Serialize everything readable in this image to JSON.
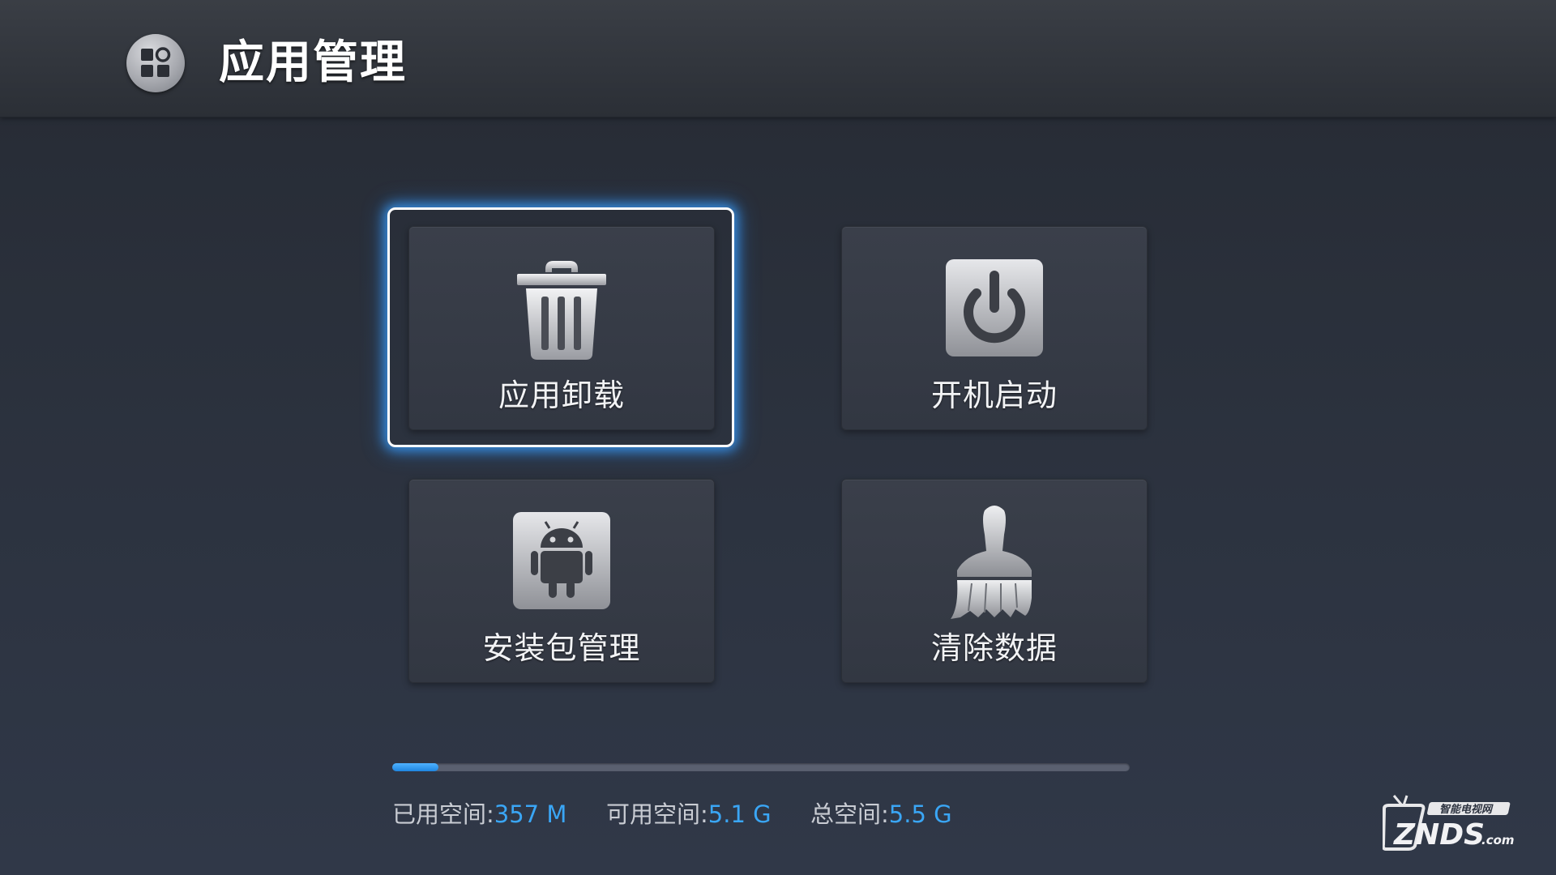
{
  "header": {
    "title": "应用管理",
    "icon": "app-grid-icon"
  },
  "tiles": [
    {
      "label": "应用卸载",
      "icon": "trash-icon",
      "focused": true
    },
    {
      "label": "开机启动",
      "icon": "power-icon",
      "focused": false
    },
    {
      "label": "安装包管理",
      "icon": "android-icon",
      "focused": false
    },
    {
      "label": "清除数据",
      "icon": "brush-icon",
      "focused": false
    }
  ],
  "storage": {
    "used_label": "已用空间:",
    "used_value": "357 M",
    "free_label": "可用空间:",
    "free_value": "5.1 G",
    "total_label": "总空间:",
    "total_value": "5.5 G",
    "used_fraction": 0.063
  },
  "watermark": {
    "top_text": "智能电视网",
    "brand": "ZNDS",
    "suffix": ".com"
  },
  "colors": {
    "accent": "#3aa6f5",
    "focus_glow": "#3ca0ff",
    "background": "#2a303b"
  }
}
